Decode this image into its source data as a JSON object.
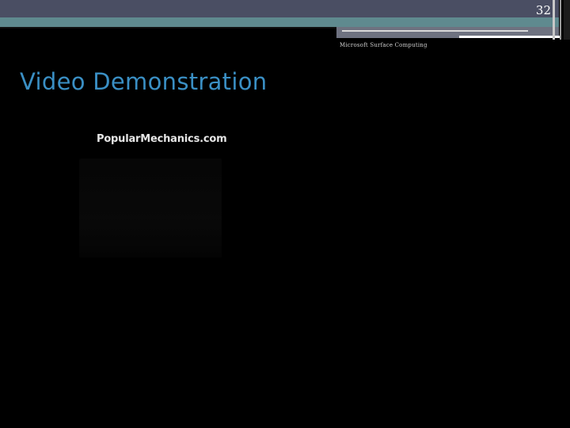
{
  "slide": {
    "number": "32",
    "footer": "Microsoft Surface Computing",
    "title": "Video Demonstration"
  },
  "video": {
    "logo_text": "PopularMechanics.com"
  },
  "colors": {
    "background": "#000000",
    "title": "#3a8fc4",
    "band_top": "#4a4e63",
    "band_teal": "#5f8a8f"
  }
}
